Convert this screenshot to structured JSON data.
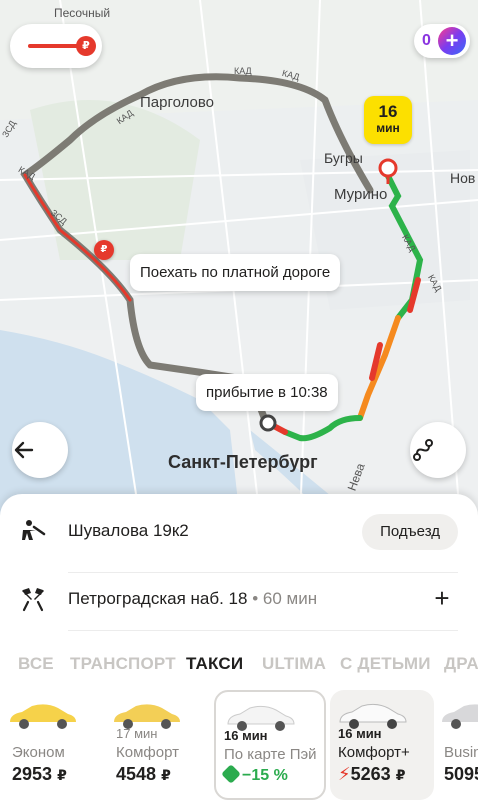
{
  "map": {
    "places": [
      "Песочный",
      "Парголово",
      "Бугры",
      "Мурино",
      "Нов",
      "Санкт-Петербург",
      "Нева"
    ],
    "road_labels": [
      "КАД",
      "КАД",
      "КАД",
      "КАД",
      "ЗСД",
      "ЗСД",
      "КАД",
      "КАД"
    ],
    "toll_tooltip": "Поехать по платной дороге",
    "arrival_tooltip": "прибытие в 10:38",
    "eta": {
      "value": "16",
      "unit": "мин"
    },
    "plus_count": "0",
    "plus_symbol": "+",
    "toll_symbol": "₽",
    "colors": {
      "route_green": "#2db34a",
      "route_red": "#e5392c",
      "route_orange": "#f58a1f",
      "alt_route": "#7d7b74",
      "badge": "#fce000"
    }
  },
  "buttons": {
    "back_icon": "arrow-left",
    "route_icon": "route-swap"
  },
  "sheet": {
    "pickup": {
      "address": "Шувалова 19к2",
      "action": "Подъезд"
    },
    "destination": {
      "address": "Петроградская наб. 18",
      "eta": "60 мин",
      "separator": "•",
      "add": "+"
    },
    "tabs": [
      "ВСЕ",
      "ТРАНСПОРТ",
      "ТАКСИ",
      "ULTIMA",
      "С ДЕТЬМИ",
      "ДРА"
    ],
    "active_tab": "ТАКСИ",
    "tariffs": [
      {
        "name": "Эконом",
        "time": "",
        "price": "2953",
        "currency": "₽"
      },
      {
        "name": "Комфорт",
        "time": "17 мин",
        "price": "4548",
        "currency": "₽"
      },
      {
        "name": "По карте Пэй",
        "time": "16 мин",
        "discount": "−15 %",
        "price": ""
      },
      {
        "name": "Комфорт+",
        "time": "16 мин",
        "price": "5263",
        "currency": "₽"
      },
      {
        "name": "Busin",
        "time": "",
        "price": "5095",
        "currency": ""
      }
    ]
  }
}
